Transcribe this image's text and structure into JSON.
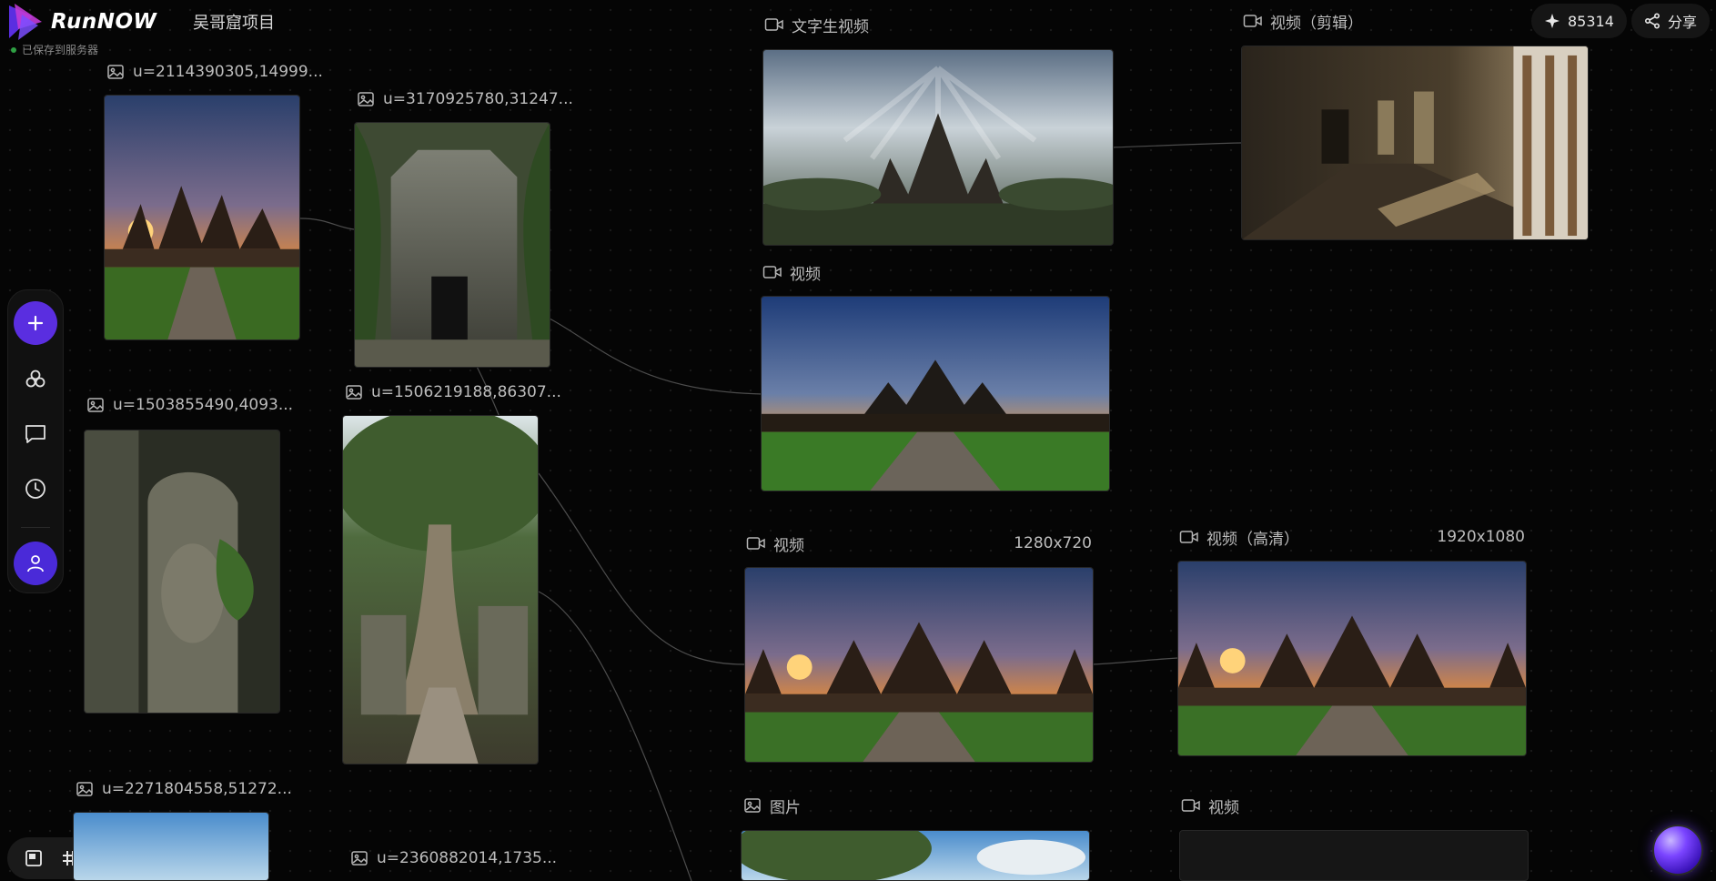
{
  "app": {
    "logo_text": "RunNOW",
    "project_title": "吴哥窟项目",
    "save_status": "已保存到服务器"
  },
  "header": {
    "credits": "85314",
    "share_label": "分享"
  },
  "toolbar": {
    "items": [
      "add",
      "nodes",
      "chat",
      "history",
      "user"
    ]
  },
  "bottombar": {
    "zoom_level": 0.25
  },
  "accent_color": "#5a2ee0",
  "nodes": [
    {
      "title": "u=2114390305,14999...",
      "kind": "image"
    },
    {
      "title": "u=3170925780,31247...",
      "kind": "image"
    },
    {
      "title": "u=1503855490,4093...",
      "kind": "image"
    },
    {
      "title": "u=1506219188,86307...",
      "kind": "image"
    },
    {
      "title": "u=2271804558,51272...",
      "kind": "image"
    },
    {
      "title": "u=2360882014,1735...",
      "kind": "image"
    },
    {
      "title": "文字生视频",
      "kind": "video"
    },
    {
      "title": "视频（剪辑）",
      "kind": "video"
    },
    {
      "title": "视频",
      "kind": "video"
    },
    {
      "title": "视频",
      "kind": "video",
      "resolution": "1280x720"
    },
    {
      "title": "视频（高清）",
      "kind": "video",
      "resolution": "1920x1080"
    },
    {
      "title": "图片",
      "kind": "image"
    },
    {
      "title": "视频",
      "kind": "video"
    }
  ]
}
